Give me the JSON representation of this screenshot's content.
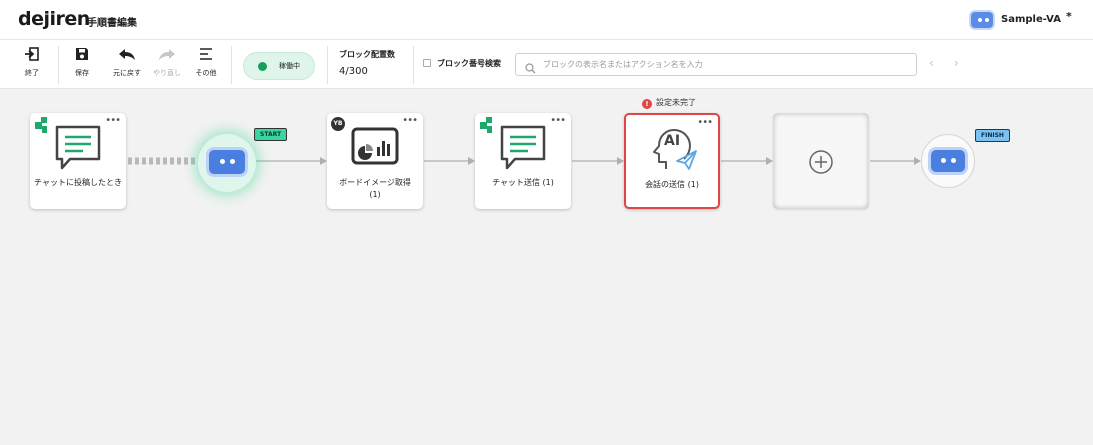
{
  "header": {
    "logo": "dejiren",
    "title": "手順書編集",
    "va_name": "Sample-VA",
    "unsaved_mark": "*"
  },
  "toolbar": {
    "exit_label": "終了",
    "save_label": "保存",
    "undo_label": "元に戻す",
    "redo_label": "やり直し",
    "other_label": "その他",
    "status_label": "稼働中",
    "placement_label": "ブロック配置数",
    "placement_value": "4/300",
    "block_number_search_label": "ブロック番号検索",
    "search_placeholder": "ブロックの表示名またはアクション名を入力",
    "search_value": ""
  },
  "flow": {
    "start_tag": "START",
    "finish_tag": "FINISH",
    "warning_text": "設定未完了",
    "more_glyph": "•••",
    "board_badge": "YB",
    "ai_text": "AI",
    "nodes": [
      {
        "label": "チャットに投稿したとき",
        "icon": "chat-bubble-icon",
        "has_warning": false
      },
      {
        "label": "ボードイメージ取得\n(1)",
        "icon": "board-image-icon",
        "has_warning": false
      },
      {
        "label": "チャット送信 (1)",
        "icon": "chat-bubble-icon",
        "has_warning": false
      },
      {
        "label": "会話の送信 (1)",
        "icon": "ai-send-icon",
        "has_warning": true
      }
    ]
  },
  "colors": {
    "accent_green": "#14a05a",
    "chat_green": "#1fa86b",
    "bot_blue": "#4a7fe0",
    "error_red": "#e04646",
    "start_tag": "#3ad6a0",
    "finish_tag": "#79c2f2"
  }
}
